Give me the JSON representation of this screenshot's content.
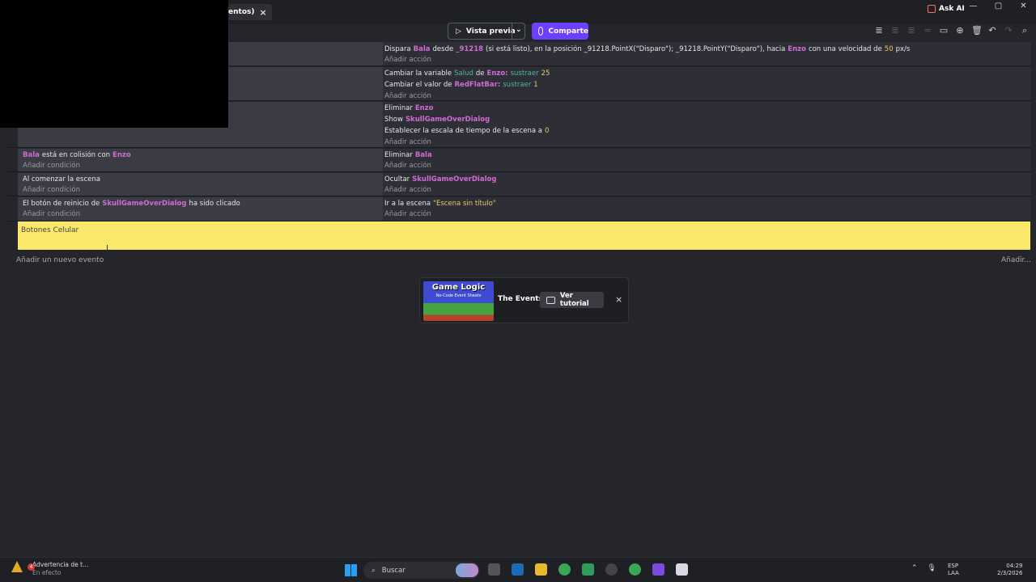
{
  "tab": {
    "label": "entos)",
    "close": "×"
  },
  "askai": {
    "label": "Ask AI"
  },
  "window_controls": [
    "—",
    "▢",
    "✕"
  ],
  "toolbar": {
    "preview_label": "Vista previa",
    "share_label": "Comparte",
    "icons": [
      "layers-icon",
      "layers-disabled-icon",
      "layers-disabled-icon",
      "wave-disabled-icon",
      "comment-icon",
      "add-icon",
      "delete-icon",
      "undo-icon",
      "redo-disabled-icon",
      "search-icon"
    ]
  },
  "events": [
    {
      "conditions": [],
      "add_condition": "",
      "actions": [
        {
          "parts": [
            {
              "t": "Dispara "
            },
            {
              "t": "Bala",
              "c": "obj"
            },
            {
              "t": " desde "
            },
            {
              "t": "_91218",
              "c": "obj"
            },
            {
              "t": " (si está listo), en la posición _91218.PointX(\"Disparo\"); _91218.PointY(\"Disparo\"), hacia "
            },
            {
              "t": "Enzo",
              "c": "obj"
            },
            {
              "t": " con una velocidad de "
            },
            {
              "t": "50",
              "c": "num"
            },
            {
              "t": " px/s"
            }
          ]
        }
      ],
      "add_action": "Añadir acción"
    },
    {
      "conditions": [],
      "add_condition": "",
      "actions": [
        {
          "parts": [
            {
              "t": "Cambiar la variable "
            },
            {
              "t": "Salud",
              "c": "var"
            },
            {
              "t": " de "
            },
            {
              "t": "Enzo:",
              "c": "obj"
            },
            {
              "t": " sustraer",
              "c": "var"
            },
            {
              "t": " 25",
              "c": "num"
            }
          ]
        },
        {
          "parts": [
            {
              "t": "Cambiar el valor de "
            },
            {
              "t": "RedFlatBar:",
              "c": "obj"
            },
            {
              "t": " sustraer",
              "c": "var"
            },
            {
              "t": " 1",
              "c": "num"
            }
          ]
        }
      ],
      "add_action": "Añadir acción"
    },
    {
      "conditions": [],
      "add_condition": "",
      "actions": [
        {
          "parts": [
            {
              "t": "Eliminar "
            },
            {
              "t": "Enzo",
              "c": "obj"
            }
          ]
        },
        {
          "parts": [
            {
              "t": "Show "
            },
            {
              "t": "SkullGameOverDialog",
              "c": "obj"
            }
          ]
        },
        {
          "parts": [
            {
              "t": "Establecer la escala de tiempo de la escena a "
            },
            {
              "t": "0",
              "c": "num"
            }
          ]
        }
      ],
      "add_action": "Añadir acción"
    },
    {
      "conditions": [
        {
          "parts": [
            {
              "t": "Bala",
              "c": "obj"
            },
            {
              "t": " está en colisión con "
            },
            {
              "t": "Enzo",
              "c": "obj"
            }
          ]
        }
      ],
      "add_condition": "Añadir condición",
      "actions": [
        {
          "parts": [
            {
              "t": "Eliminar "
            },
            {
              "t": "Bala",
              "c": "obj"
            }
          ]
        }
      ],
      "add_action": "Añadir acción"
    },
    {
      "conditions": [
        {
          "parts": [
            {
              "t": "Al comenzar la escena"
            }
          ]
        }
      ],
      "add_condition": "Añadir condición",
      "actions": [
        {
          "parts": [
            {
              "t": "Ocultar "
            },
            {
              "t": "SkullGameOverDialog",
              "c": "obj"
            }
          ]
        }
      ],
      "add_action": "Añadir acción"
    },
    {
      "conditions": [
        {
          "parts": [
            {
              "t": "El botón de reinicio de "
            },
            {
              "t": "SkullGameOverDialog",
              "c": "obj"
            },
            {
              "t": " ha sido clicado"
            }
          ]
        }
      ],
      "add_condition": "Añadir condición",
      "actions": [
        {
          "parts": [
            {
              "t": "Ir a la escena "
            },
            {
              "t": "\"Escena sin título\"",
              "c": "str"
            }
          ]
        }
      ],
      "add_action": "Añadir acción"
    }
  ],
  "comment": {
    "text": "Botones Celular"
  },
  "add_event": {
    "label": "Añadir un nuevo evento",
    "more": "Añadir..."
  },
  "tutorial": {
    "thumb_title": "Game Logic",
    "thumb_sub": "No-Code Event Sheets",
    "name": "The Events",
    "button": "Ver tutorial",
    "close": "×"
  },
  "taskbar": {
    "notif_title": "Advertencia de t...",
    "notif_sub": "En efecto",
    "notif_count": "4",
    "search_placeholder": "Buscar",
    "lang1": "ESP",
    "lang2": "LAA",
    "time": "04:29",
    "date": "2/3/2026"
  }
}
